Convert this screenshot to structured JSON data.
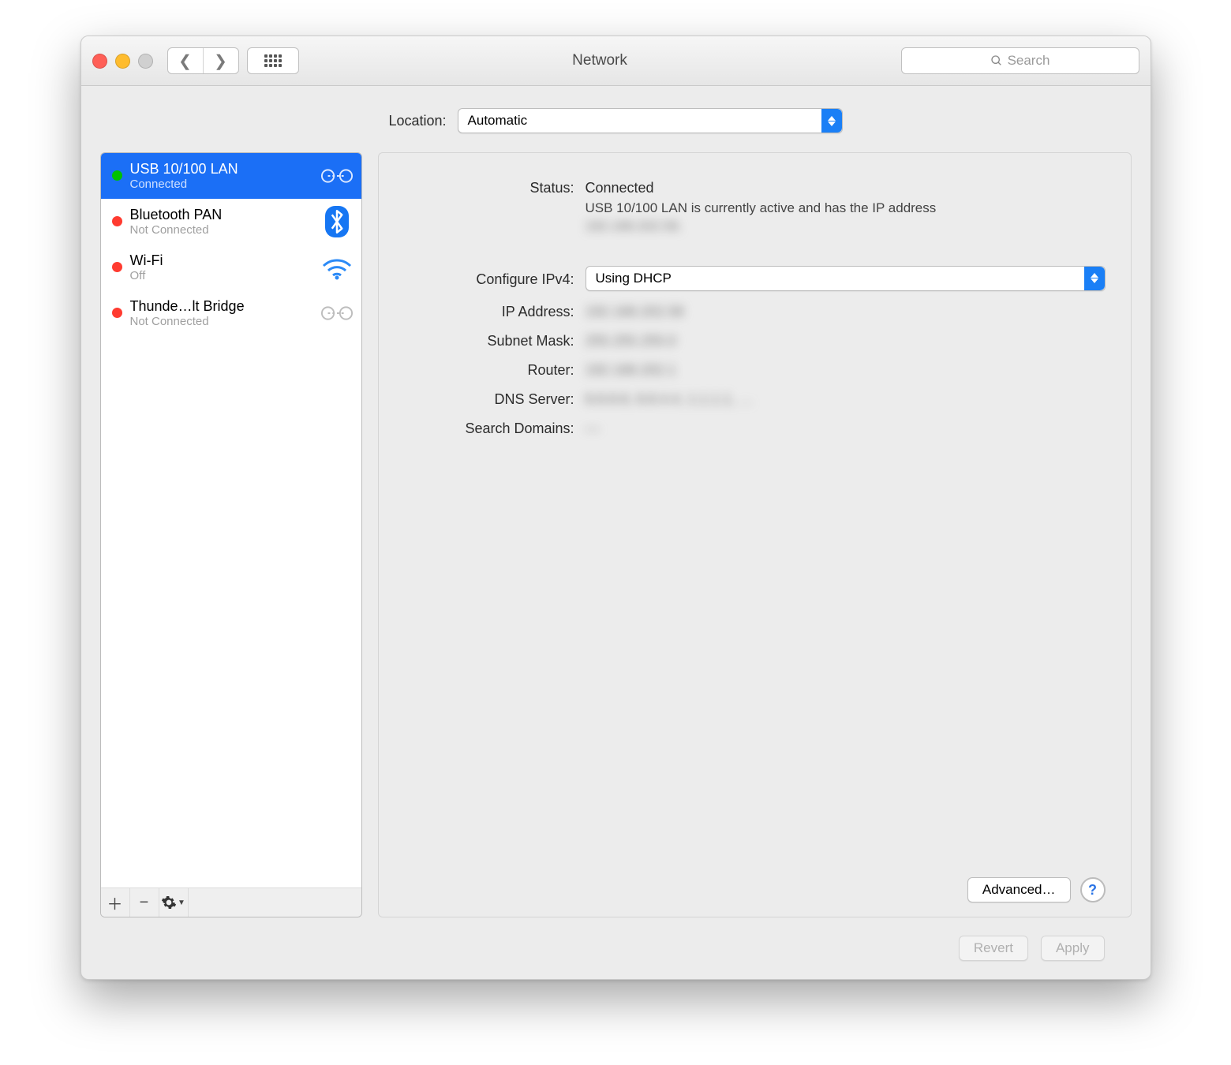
{
  "window": {
    "title": "Network"
  },
  "toolbar": {
    "search_placeholder": "Search"
  },
  "location": {
    "label": "Location:",
    "value": "Automatic"
  },
  "services": [
    {
      "name": "USB 10/100 LAN",
      "status": "Connected",
      "statusColor": "green",
      "iconType": "ethernet",
      "selected": true
    },
    {
      "name": "Bluetooth PAN",
      "status": "Not Connected",
      "statusColor": "red",
      "iconType": "bluetooth",
      "selected": false
    },
    {
      "name": "Wi-Fi",
      "status": "Off",
      "statusColor": "red",
      "iconType": "wifi",
      "selected": false
    },
    {
      "name": "Thunde…lt Bridge",
      "status": "Not Connected",
      "statusColor": "red",
      "iconType": "ethernet-gray",
      "selected": false
    }
  ],
  "detail": {
    "status_label": "Status:",
    "status_value": "Connected",
    "status_sub_prefix": "USB 10/100 LAN is currently active and has the IP address ",
    "status_sub_ip": "192.168.202.58.",
    "configure_label": "Configure IPv4:",
    "configure_value": "Using DHCP",
    "ip_label": "IP Address:",
    "ip_value": "192.168.202.58",
    "subnet_label": "Subnet Mask:",
    "subnet_value": "255.255.255.0",
    "router_label": "Router:",
    "router_value": "192.168.202.1",
    "dns_label": "DNS Server:",
    "dns_value": "8.8.8.8, 8.8.4.4, 1.1.1.1, …",
    "search_label": "Search Domains:",
    "search_value": "—",
    "advanced_label": "Advanced…"
  },
  "footer": {
    "revert": "Revert",
    "apply": "Apply"
  }
}
